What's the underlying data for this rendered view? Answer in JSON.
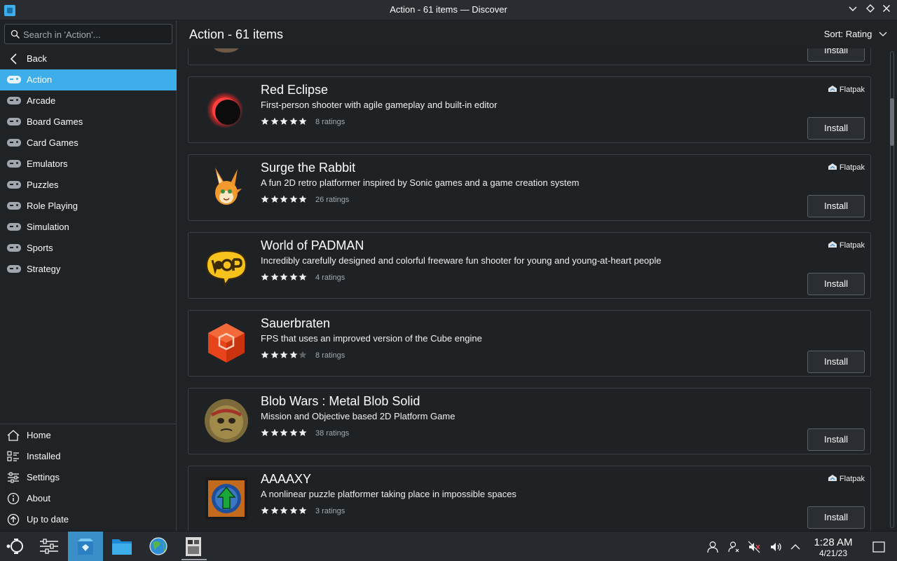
{
  "window": {
    "title": "Action - 61 items — Discover",
    "controls": [
      "minimize",
      "maximize",
      "close"
    ]
  },
  "sidebar": {
    "search": {
      "placeholder": "Search in 'Action'...",
      "value": ""
    },
    "back_label": "Back",
    "categories": [
      {
        "label": "Action",
        "active": true
      },
      {
        "label": "Arcade"
      },
      {
        "label": "Board Games"
      },
      {
        "label": "Card Games"
      },
      {
        "label": "Emulators"
      },
      {
        "label": "Puzzles"
      },
      {
        "label": "Role Playing"
      },
      {
        "label": "Simulation"
      },
      {
        "label": "Sports"
      },
      {
        "label": "Strategy"
      }
    ],
    "bottom": [
      {
        "label": "Home",
        "icon": "home-icon"
      },
      {
        "label": "Installed",
        "icon": "installed-icon"
      },
      {
        "label": "Settings",
        "icon": "settings-icon"
      },
      {
        "label": "About",
        "icon": "about-icon"
      },
      {
        "label": "Up to date",
        "icon": "update-icon"
      }
    ]
  },
  "header": {
    "title": "Action - 61 items",
    "sort_label": "Sort: Rating"
  },
  "apps": [
    {
      "name": "",
      "description": "",
      "ratings": "",
      "flatpak": false,
      "install_label": "Install",
      "partial": true
    },
    {
      "name": "Red Eclipse",
      "description": "First-person shooter with agile gameplay and built-in editor",
      "stars": 5,
      "ratings": "8 ratings",
      "flatpak": true,
      "source_label": "Flatpak",
      "install_label": "Install"
    },
    {
      "name": "Surge the Rabbit",
      "description": "A fun 2D retro platformer inspired by Sonic games and a game creation system",
      "stars": 5,
      "ratings": "26 ratings",
      "flatpak": true,
      "source_label": "Flatpak",
      "install_label": "Install"
    },
    {
      "name": "World of PADMAN",
      "description": "Incredibly carefully designed and colorful freeware fun shooter for young and young-at-heart people",
      "stars": 5,
      "ratings": "4 ratings",
      "flatpak": true,
      "source_label": "Flatpak",
      "install_label": "Install"
    },
    {
      "name": "Sauerbraten",
      "description": "FPS that uses an improved version of the Cube engine",
      "stars": 4,
      "ratings": "8 ratings",
      "flatpak": false,
      "install_label": "Install"
    },
    {
      "name": "Blob Wars : Metal Blob Solid",
      "description": "Mission and Objective based 2D Platform Game",
      "stars": 5,
      "ratings": "38 ratings",
      "flatpak": false,
      "install_label": "Install"
    },
    {
      "name": "AAAAXY",
      "description": "A nonlinear puzzle platformer taking place in impossible spaces",
      "stars": 5,
      "ratings": "3 ratings",
      "flatpak": true,
      "source_label": "Flatpak",
      "install_label": "Install"
    }
  ],
  "scroll_position": 0.1,
  "taskbar": {
    "time": "1:28 AM",
    "date": "4/21/23"
  },
  "colors": {
    "accent": "#3daee9",
    "background": "#202326",
    "star": "#eff0f1",
    "star_empty": "#5d6268"
  }
}
